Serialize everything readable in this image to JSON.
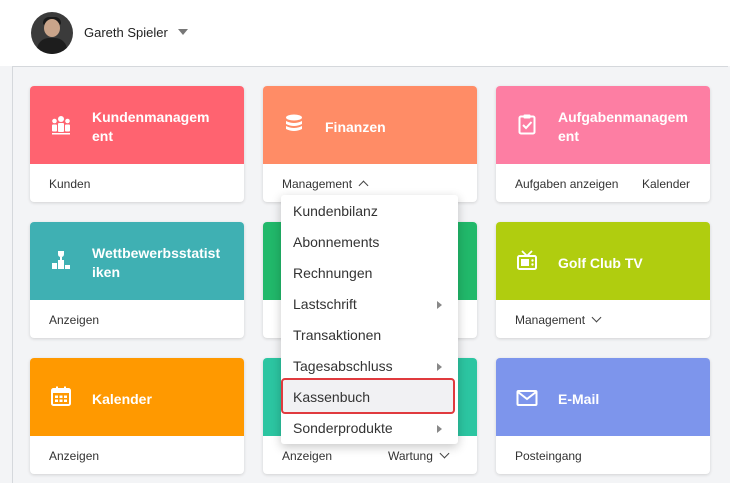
{
  "user": {
    "name": "Gareth Spieler"
  },
  "cards": {
    "kunden": {
      "title": "Kundenmanagem ent",
      "color": "#ff6370",
      "link1": "Kunden"
    },
    "finanzen": {
      "title": "Finanzen",
      "color": "#ff8c66",
      "link1": "Management"
    },
    "aufgaben": {
      "title": "Aufgabenmanagem ent",
      "color": "#fd7ea3",
      "link1": "Aufgaben anzeigen",
      "link2": "Kalender"
    },
    "wettbewerb": {
      "title": "Wettbewerbsstatist iken",
      "color": "#3fb0b3",
      "link1": "Anzeigen"
    },
    "middle2": {
      "color": "#21b86a"
    },
    "golftv": {
      "title": "Golf Club TV",
      "color": "#b0cd0f",
      "link1": "Management"
    },
    "kalender": {
      "title": "Kalender",
      "color": "#ff9900",
      "link1": "Anzeigen"
    },
    "middle3": {
      "color": "#2cc5a1",
      "link1": "Anzeigen",
      "link2": "Wartung"
    },
    "email": {
      "title": "E-Mail",
      "color": "#7d95ec",
      "link1": "Posteingang"
    }
  },
  "menu": {
    "items": [
      "Kundenbilanz",
      "Abonnements",
      "Rechnungen",
      "Lastschrift",
      "Transaktionen",
      "Tagesabschluss",
      "Kassenbuch",
      "Sonderprodukte"
    ],
    "highlighted": "Kassenbuch",
    "highlight_color": "#e03a3e"
  }
}
